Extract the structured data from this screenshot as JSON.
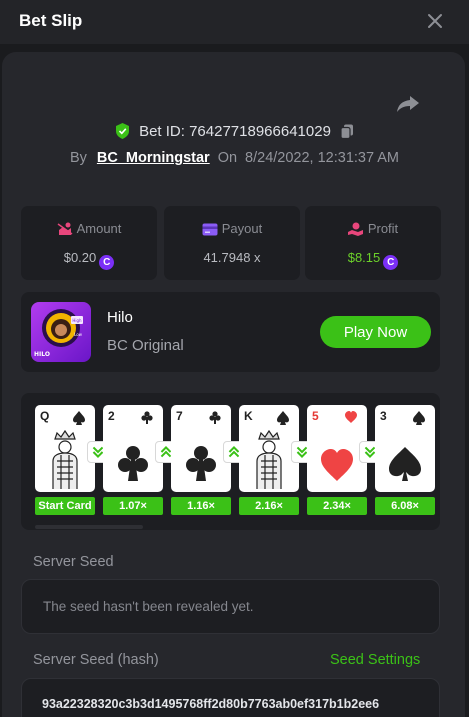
{
  "header": {
    "title": "Bet Slip"
  },
  "bet": {
    "id_label": "Bet ID:",
    "id_value": "76427718966641029",
    "by_label": "By",
    "username": "BC_Morningstar",
    "on_label": "On",
    "datetime": "8/24/2022, 12:31:37 AM"
  },
  "stats": {
    "amount": {
      "label": "Amount",
      "value": "$0.20",
      "icon": "amount-icon"
    },
    "payout": {
      "label": "Payout",
      "value": "41.7948 x",
      "icon": "card-icon"
    },
    "profit": {
      "label": "Profit",
      "value": "$8.15",
      "icon": "profit-icon"
    }
  },
  "coin_symbol": "C",
  "game": {
    "name": "Hilo",
    "subtitle": "BC Original",
    "play_label": "Play Now",
    "icon_text": "HILO",
    "icon_hi": "High",
    "icon_lo": "Low"
  },
  "cards": [
    {
      "rank": "Q",
      "suit": "spade",
      "label": "Start Card",
      "guess": "lower"
    },
    {
      "rank": "2",
      "suit": "club",
      "label": "1.07×",
      "guess": "higher"
    },
    {
      "rank": "7",
      "suit": "club",
      "label": "1.16×",
      "guess": "higher"
    },
    {
      "rank": "K",
      "suit": "spade",
      "label": "2.16×",
      "guess": "lower"
    },
    {
      "rank": "5",
      "suit": "heart",
      "label": "2.34×",
      "guess": "lower"
    },
    {
      "rank": "3",
      "suit": "spade",
      "label": "6.08×",
      "guess": ""
    }
  ],
  "server_seed": {
    "label": "Server Seed",
    "value": "The seed hasn't been revealed yet."
  },
  "server_seed_hash": {
    "label": "Server Seed (hash)",
    "settings_label": "Seed Settings",
    "value": "93a22328320c3b3d1495768ff2d80b7763ab0ef317b1b2ee6"
  },
  "colors": {
    "accent_green": "#3bc117",
    "coin_purple": "#7b2ff7",
    "verify_green": "#3bc117",
    "amount_pink": "#e8467c",
    "payout_purple": "#8b5cf6",
    "profit_red": "#e8467c"
  }
}
